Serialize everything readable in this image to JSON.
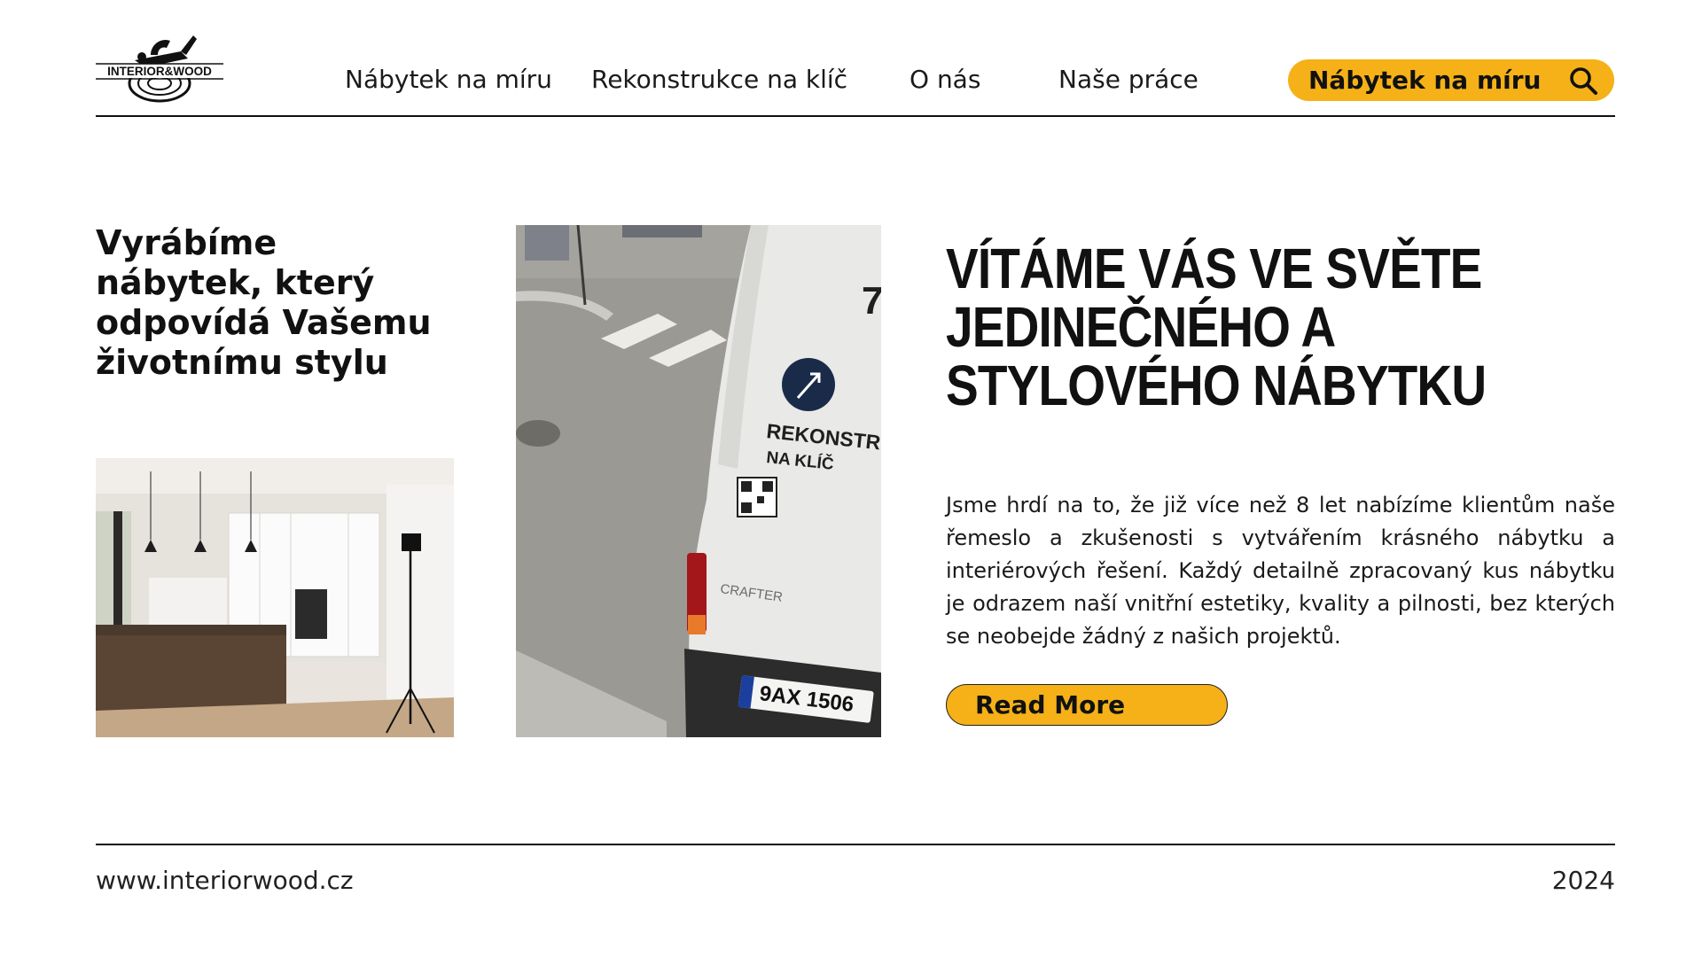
{
  "brand": {
    "logo_text": "INTERIOR&WOOD"
  },
  "nav": {
    "items": [
      {
        "label": "Nábytek na míru"
      },
      {
        "label": "Rekonstrukce na klíč"
      },
      {
        "label": "O nás"
      },
      {
        "label": "Naše práce"
      }
    ],
    "search_pill": {
      "label": "Nábytek na míru",
      "icon": "search-icon"
    }
  },
  "hero": {
    "tagline": "Vyrábíme nábytek, který odpovídá Vašemu životnímu stylu",
    "headline": "VÍTÁME VÁS VE SVĚTE JEDINEČNÉHO A STYLOVÉHO NÁBYTKU",
    "body": "Jsme hrdí na to, že již více než 8 let nabízíme klientům naše řemeslo a zkušenosti s vytvářením krásného nábytku a interiérových řešení. Každý detailně zpracovaný kus nábytku je odrazem naší vnitřní estetiky, kvality a pilnosti, bez kterých se neobejde žádný z našich projektů.",
    "cta_label": "Read More"
  },
  "photos": {
    "kitchen": {
      "subject": "kitchen interior"
    },
    "van": {
      "subject": "company van",
      "van_text_line1": "REKONSTR",
      "van_text_line2": "NA KLÍČ",
      "van_model": "CRAFTER",
      "plate": "9AX 1506"
    }
  },
  "footer": {
    "url": "www.interiorwood.cz",
    "year": "2024"
  },
  "colors": {
    "accent": "#f5b117",
    "text": "#111111",
    "background": "#ffffff"
  }
}
